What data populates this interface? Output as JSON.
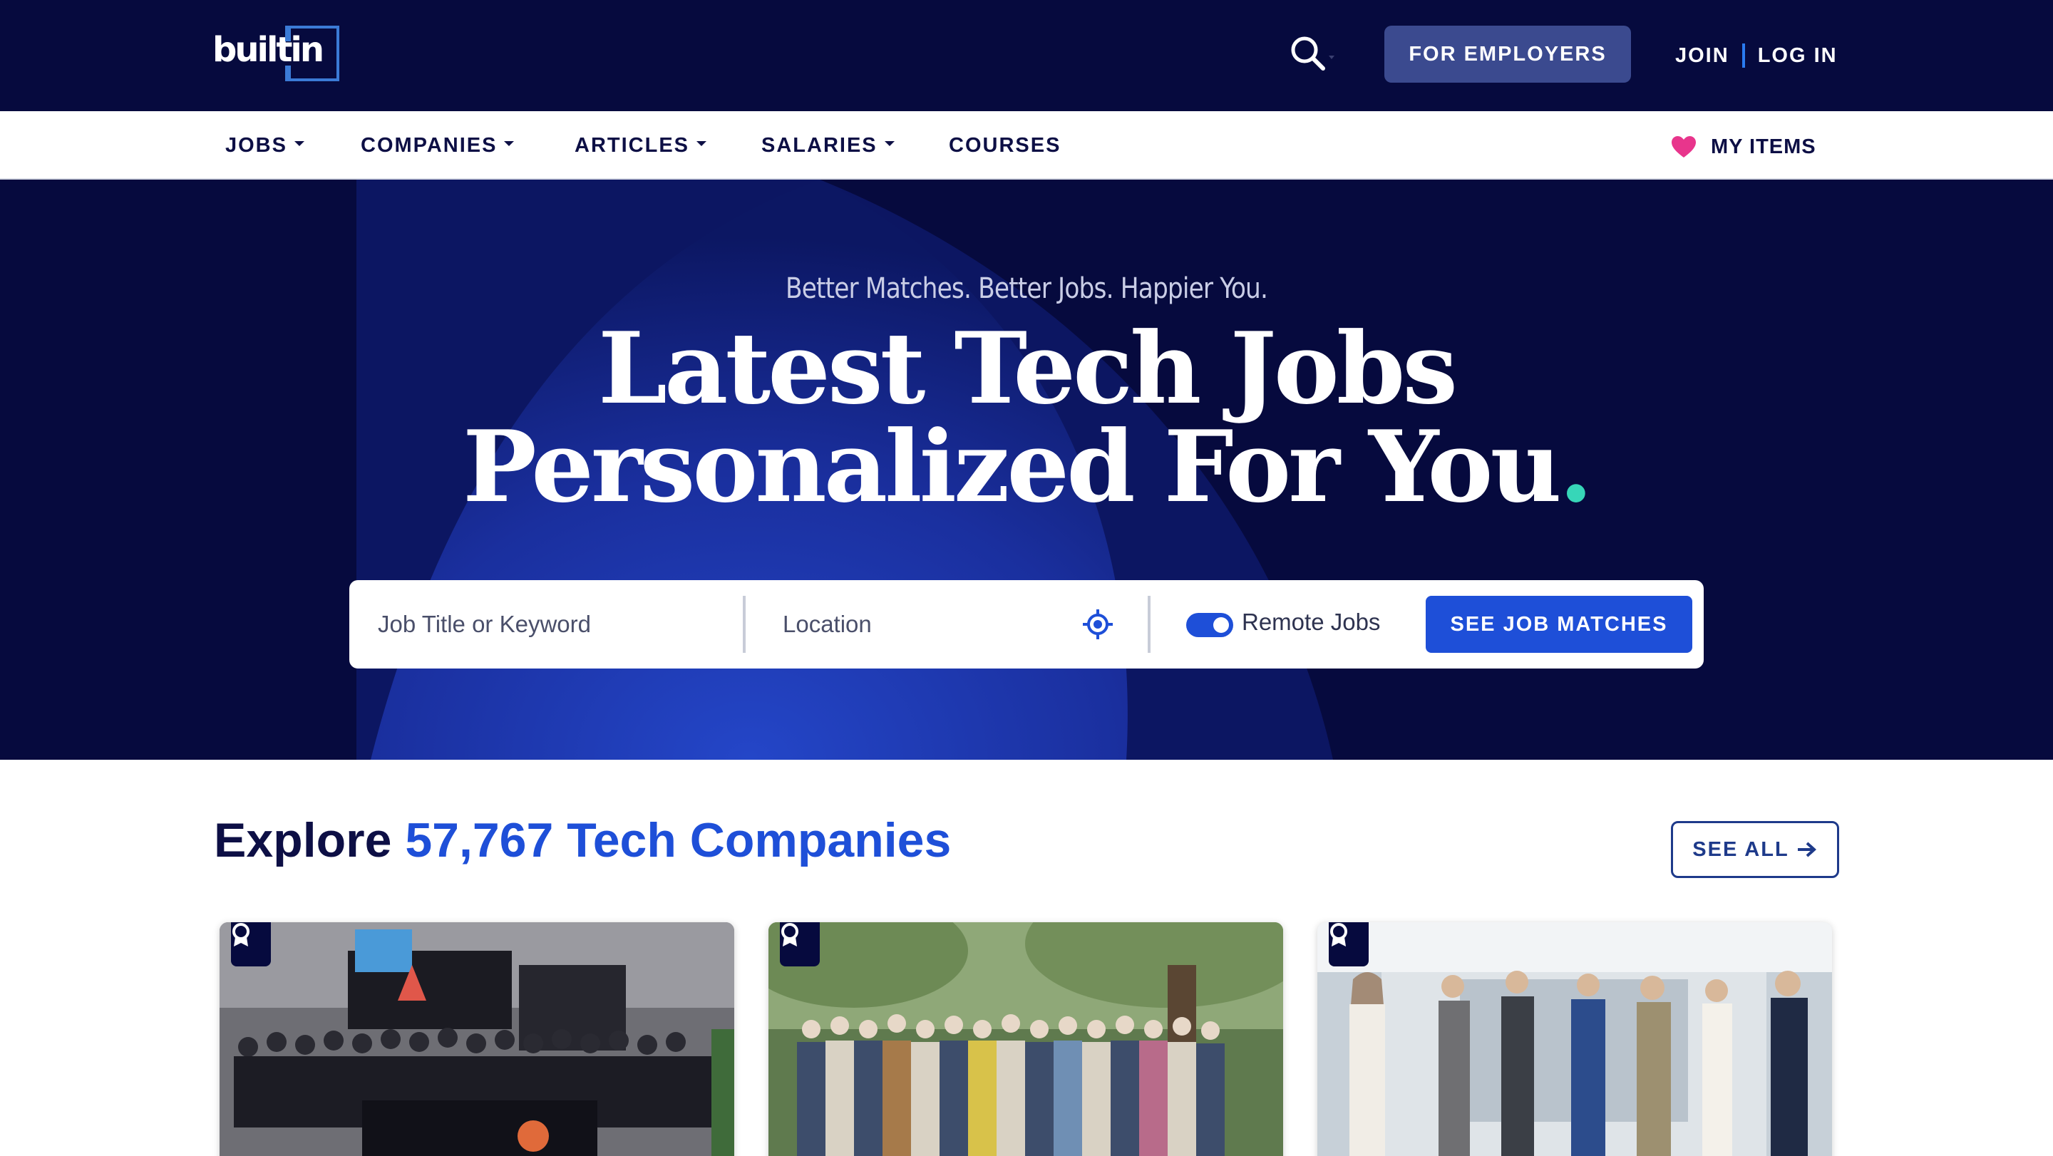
{
  "header": {
    "logo_text": "builtin",
    "search_icon": "search-icon",
    "employers_label": "FOR EMPLOYERS",
    "join_label": "JOIN",
    "login_label": "LOG IN"
  },
  "nav": {
    "items": [
      {
        "label": "JOBS",
        "dropdown": true
      },
      {
        "label": "COMPANIES",
        "dropdown": true
      },
      {
        "label": "ARTICLES",
        "dropdown": true
      },
      {
        "label": "SALARIES",
        "dropdown": true
      },
      {
        "label": "COURSES",
        "dropdown": false
      }
    ],
    "my_items_label": "MY ITEMS",
    "my_items_icon": "heart-icon"
  },
  "hero": {
    "tagline": "Better Matches. Better Jobs. Happier You.",
    "headline_line1": "Latest Tech Jobs",
    "headline_line2": "Personalized For You",
    "headline_dot": ".",
    "search": {
      "keyword_placeholder": "Job Title or Keyword",
      "location_placeholder": "Location",
      "locate_icon": "crosshair-icon",
      "remote_label": "Remote Jobs",
      "remote_enabled": true,
      "submit_label": "SEE JOB MATCHES"
    }
  },
  "explore": {
    "title_prefix": "Explore",
    "count": "57,767",
    "title_suffix": "Tech Companies",
    "see_all_label": "SEE ALL",
    "see_all_icon": "arrow-right-icon",
    "cards": [
      {
        "badge_icon": "award-ribbon-icon",
        "photo": "company-booth-group-photo"
      },
      {
        "badge_icon": "award-ribbon-icon",
        "photo": "outdoor-team-group-photo"
      },
      {
        "badge_icon": "award-ribbon-icon",
        "photo": "office-walking-team-photo"
      }
    ]
  },
  "colors": {
    "navy": "#060a3e",
    "brand_blue": "#1e4fd8",
    "teal_dot": "#37d6b8",
    "heart_pink": "#e8358c",
    "employer_button": "#3b4a8f"
  }
}
